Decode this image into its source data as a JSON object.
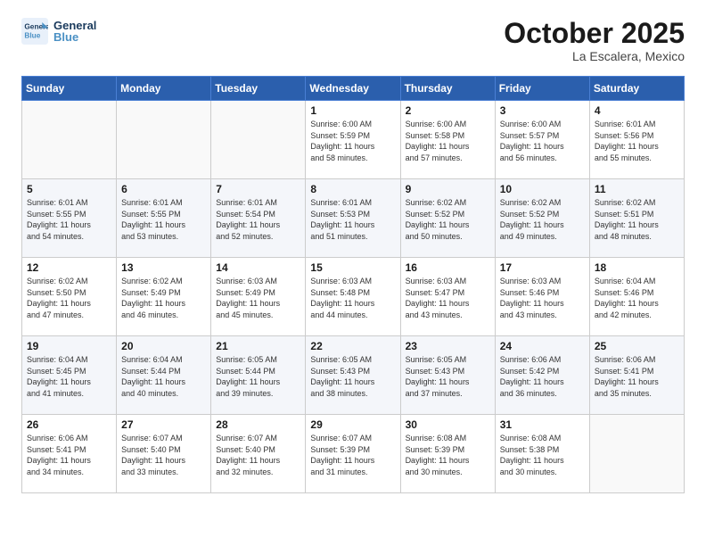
{
  "header": {
    "logo_line1": "General",
    "logo_line2": "Blue",
    "month": "October 2025",
    "location": "La Escalera, Mexico"
  },
  "weekdays": [
    "Sunday",
    "Monday",
    "Tuesday",
    "Wednesday",
    "Thursday",
    "Friday",
    "Saturday"
  ],
  "weeks": [
    [
      {
        "day": "",
        "info": ""
      },
      {
        "day": "",
        "info": ""
      },
      {
        "day": "",
        "info": ""
      },
      {
        "day": "1",
        "info": "Sunrise: 6:00 AM\nSunset: 5:59 PM\nDaylight: 11 hours\nand 58 minutes."
      },
      {
        "day": "2",
        "info": "Sunrise: 6:00 AM\nSunset: 5:58 PM\nDaylight: 11 hours\nand 57 minutes."
      },
      {
        "day": "3",
        "info": "Sunrise: 6:00 AM\nSunset: 5:57 PM\nDaylight: 11 hours\nand 56 minutes."
      },
      {
        "day": "4",
        "info": "Sunrise: 6:01 AM\nSunset: 5:56 PM\nDaylight: 11 hours\nand 55 minutes."
      }
    ],
    [
      {
        "day": "5",
        "info": "Sunrise: 6:01 AM\nSunset: 5:55 PM\nDaylight: 11 hours\nand 54 minutes."
      },
      {
        "day": "6",
        "info": "Sunrise: 6:01 AM\nSunset: 5:55 PM\nDaylight: 11 hours\nand 53 minutes."
      },
      {
        "day": "7",
        "info": "Sunrise: 6:01 AM\nSunset: 5:54 PM\nDaylight: 11 hours\nand 52 minutes."
      },
      {
        "day": "8",
        "info": "Sunrise: 6:01 AM\nSunset: 5:53 PM\nDaylight: 11 hours\nand 51 minutes."
      },
      {
        "day": "9",
        "info": "Sunrise: 6:02 AM\nSunset: 5:52 PM\nDaylight: 11 hours\nand 50 minutes."
      },
      {
        "day": "10",
        "info": "Sunrise: 6:02 AM\nSunset: 5:52 PM\nDaylight: 11 hours\nand 49 minutes."
      },
      {
        "day": "11",
        "info": "Sunrise: 6:02 AM\nSunset: 5:51 PM\nDaylight: 11 hours\nand 48 minutes."
      }
    ],
    [
      {
        "day": "12",
        "info": "Sunrise: 6:02 AM\nSunset: 5:50 PM\nDaylight: 11 hours\nand 47 minutes."
      },
      {
        "day": "13",
        "info": "Sunrise: 6:02 AM\nSunset: 5:49 PM\nDaylight: 11 hours\nand 46 minutes."
      },
      {
        "day": "14",
        "info": "Sunrise: 6:03 AM\nSunset: 5:49 PM\nDaylight: 11 hours\nand 45 minutes."
      },
      {
        "day": "15",
        "info": "Sunrise: 6:03 AM\nSunset: 5:48 PM\nDaylight: 11 hours\nand 44 minutes."
      },
      {
        "day": "16",
        "info": "Sunrise: 6:03 AM\nSunset: 5:47 PM\nDaylight: 11 hours\nand 43 minutes."
      },
      {
        "day": "17",
        "info": "Sunrise: 6:03 AM\nSunset: 5:46 PM\nDaylight: 11 hours\nand 43 minutes."
      },
      {
        "day": "18",
        "info": "Sunrise: 6:04 AM\nSunset: 5:46 PM\nDaylight: 11 hours\nand 42 minutes."
      }
    ],
    [
      {
        "day": "19",
        "info": "Sunrise: 6:04 AM\nSunset: 5:45 PM\nDaylight: 11 hours\nand 41 minutes."
      },
      {
        "day": "20",
        "info": "Sunrise: 6:04 AM\nSunset: 5:44 PM\nDaylight: 11 hours\nand 40 minutes."
      },
      {
        "day": "21",
        "info": "Sunrise: 6:05 AM\nSunset: 5:44 PM\nDaylight: 11 hours\nand 39 minutes."
      },
      {
        "day": "22",
        "info": "Sunrise: 6:05 AM\nSunset: 5:43 PM\nDaylight: 11 hours\nand 38 minutes."
      },
      {
        "day": "23",
        "info": "Sunrise: 6:05 AM\nSunset: 5:43 PM\nDaylight: 11 hours\nand 37 minutes."
      },
      {
        "day": "24",
        "info": "Sunrise: 6:06 AM\nSunset: 5:42 PM\nDaylight: 11 hours\nand 36 minutes."
      },
      {
        "day": "25",
        "info": "Sunrise: 6:06 AM\nSunset: 5:41 PM\nDaylight: 11 hours\nand 35 minutes."
      }
    ],
    [
      {
        "day": "26",
        "info": "Sunrise: 6:06 AM\nSunset: 5:41 PM\nDaylight: 11 hours\nand 34 minutes."
      },
      {
        "day": "27",
        "info": "Sunrise: 6:07 AM\nSunset: 5:40 PM\nDaylight: 11 hours\nand 33 minutes."
      },
      {
        "day": "28",
        "info": "Sunrise: 6:07 AM\nSunset: 5:40 PM\nDaylight: 11 hours\nand 32 minutes."
      },
      {
        "day": "29",
        "info": "Sunrise: 6:07 AM\nSunset: 5:39 PM\nDaylight: 11 hours\nand 31 minutes."
      },
      {
        "day": "30",
        "info": "Sunrise: 6:08 AM\nSunset: 5:39 PM\nDaylight: 11 hours\nand 30 minutes."
      },
      {
        "day": "31",
        "info": "Sunrise: 6:08 AM\nSunset: 5:38 PM\nDaylight: 11 hours\nand 30 minutes."
      },
      {
        "day": "",
        "info": ""
      }
    ]
  ]
}
